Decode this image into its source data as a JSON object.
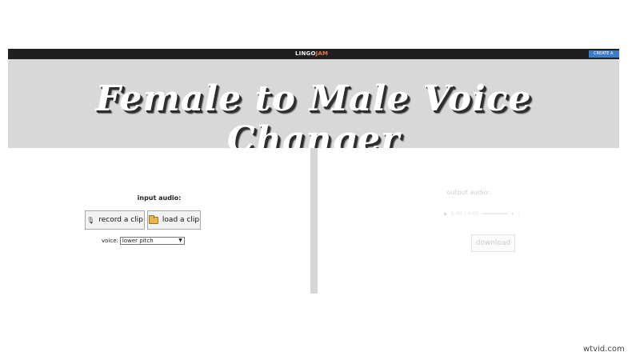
{
  "header": {
    "logo_main": "LINGO",
    "logo_accent": "JAM",
    "create_button": "CREATE A"
  },
  "banner": {
    "title": "Female to Male Voice Changer"
  },
  "input_panel": {
    "label": "input audio:",
    "record_button": "record a clip",
    "record_icon": "mic-icon",
    "load_button": "load a clip",
    "load_icon": "folder-icon",
    "voice_label": "voice:",
    "voice_selected": "lower pitch"
  },
  "output_panel": {
    "label": "output audio:",
    "player_time": "0:00 / 0:00",
    "download_button": "download"
  },
  "watermark": "wtvid.com",
  "colors": {
    "header_bg": "#1f1f1f",
    "banner_bg": "#d8d8d8",
    "create_button_bg": "#3d7cc9",
    "logo_accent": "#e8734a"
  }
}
